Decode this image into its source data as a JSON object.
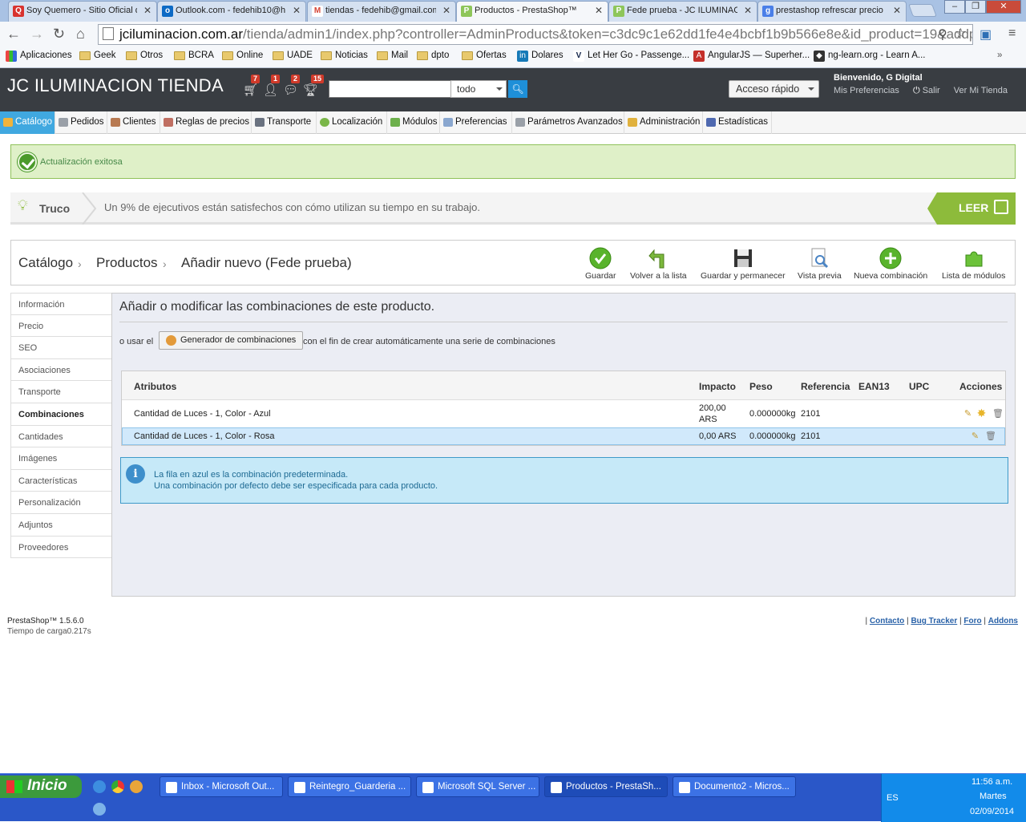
{
  "browser": {
    "tabs": [
      {
        "label": "Soy Quemero - Sitio Oficial d",
        "icon": "quemero-icon",
        "color": "#d8332f"
      },
      {
        "label": "Outlook.com - fedehib10@h",
        "icon": "outlook-icon",
        "color": "#0d6ac5"
      },
      {
        "label": "tiendas - fedehib@gmail.com",
        "icon": "gmail-icon",
        "color": "#d64536"
      },
      {
        "label": "Productos - PrestaShop™",
        "icon": "prestashop-icon",
        "color": "#8ec65a"
      },
      {
        "label": "Fede prueba - JC ILUMINAC",
        "icon": "prestashop-icon",
        "color": "#8ec65a"
      },
      {
        "label": "prestashop refrescar precio",
        "icon": "google-icon",
        "color": "#4a7fe8"
      }
    ],
    "url_host": "jciluminacion.com.ar",
    "url_rest": "/tienda/admin1/index.php?controller=AdminProducts&token=c3dc9c1e62dd1fe4e4bcbf1b9b566e8e&id_product=19&addp",
    "bookmarks": [
      {
        "label": "Aplicaciones",
        "type": "apps"
      },
      {
        "label": "Geek",
        "type": "folder"
      },
      {
        "label": "Otros",
        "type": "folder"
      },
      {
        "label": "BCRA",
        "type": "folder"
      },
      {
        "label": "Online",
        "type": "folder"
      },
      {
        "label": "UADE",
        "type": "folder"
      },
      {
        "label": "Noticias",
        "type": "folder"
      },
      {
        "label": "Mail",
        "type": "folder"
      },
      {
        "label": "dpto",
        "type": "folder"
      },
      {
        "label": "Ofertas",
        "type": "folder"
      },
      {
        "label": "Dolares",
        "type": "linkedin"
      },
      {
        "label": "Let Her Go - Passenge...",
        "type": "vimeo"
      },
      {
        "label": "AngularJS — Superher...",
        "type": "angular"
      },
      {
        "label": "ng-learn.org - Learn A...",
        "type": "ngshield"
      }
    ]
  },
  "ps": {
    "title": "JC ILUMINACION TIENDA",
    "notifications": [
      {
        "icon": "cart-icon",
        "count": "7"
      },
      {
        "icon": "customers-icon",
        "count": "1"
      },
      {
        "icon": "messages-icon",
        "count": "2"
      },
      {
        "icon": "trophy-icon",
        "count": "15"
      }
    ],
    "search_scope": "todo",
    "quick_access": "Acceso rápido",
    "welcome": "Bienvenido, G Digital",
    "links": {
      "prefs": "Mis Preferencias",
      "logout": "Salir",
      "store": "Ver Mi Tienda"
    },
    "menu": [
      {
        "label": "Catálogo",
        "active": true,
        "color": "#f0b33b"
      },
      {
        "label": "Pedidos",
        "active": false,
        "color": "#9aa0a8"
      },
      {
        "label": "Clientes",
        "active": false,
        "color": "#b87a52"
      },
      {
        "label": "Reglas de precios",
        "active": false,
        "color": "#c06f62"
      },
      {
        "label": "Transporte",
        "active": false,
        "color": "#6a7280"
      },
      {
        "label": "Localización",
        "active": false,
        "color": "#7ab648"
      },
      {
        "label": "Módulos",
        "active": false,
        "color": "#6db04c"
      },
      {
        "label": "Preferencias",
        "active": false,
        "color": "#8aa7cf"
      },
      {
        "label": "Parámetros Avanzados",
        "active": false,
        "color": "#9aa0a8"
      },
      {
        "label": "Administración",
        "active": false,
        "color": "#e0b13d"
      },
      {
        "label": "Estadísticas",
        "active": false,
        "color": "#4f69b0"
      }
    ],
    "success_msg": "Actualización exitosa",
    "tip": {
      "label": "Truco",
      "text": "Un 9% de ejecutivos están satisfechos con cómo utilizan su tiempo en su trabajo.",
      "read": "LEER"
    },
    "breadcrumb": [
      "Catálogo",
      "Productos",
      "Añadir nuevo (Fede prueba)"
    ],
    "toolbar": [
      {
        "label": "Guardar",
        "icon": "save-check-icon"
      },
      {
        "label": "Volver a la lista",
        "icon": "back-arrow-icon"
      },
      {
        "label": "Guardar y permanecer",
        "icon": "floppy-disk-icon"
      },
      {
        "label": "Vista previa",
        "icon": "preview-icon"
      },
      {
        "label": "Nueva combinación",
        "icon": "add-plus-icon"
      },
      {
        "label": "Lista de módulos",
        "icon": "puzzle-icon"
      }
    ],
    "side_tabs": [
      {
        "label": "Información"
      },
      {
        "label": "Precio"
      },
      {
        "label": "SEO"
      },
      {
        "label": "Asociaciones"
      },
      {
        "label": "Transporte"
      },
      {
        "label": "Combinaciones",
        "active": true
      },
      {
        "label": "Cantidades"
      },
      {
        "label": "Imágenes"
      },
      {
        "label": "Características"
      },
      {
        "label": "Personalización"
      },
      {
        "label": "Adjuntos"
      },
      {
        "label": "Proveedores"
      }
    ],
    "panel_title": "Añadir o modificar las combinaciones de este producto.",
    "gen_prefix": "o usar el",
    "gen_button": "Generador de combinaciones",
    "gen_suffix": "con el fin de crear automáticamente una serie de combinaciones",
    "table": {
      "headers": [
        "Atributos",
        "Impacto",
        "Peso",
        "Referencia",
        "EAN13",
        "UPC",
        "Acciones"
      ],
      "rows": [
        {
          "attr": "Cantidad de Luces - 1, Color - Azul",
          "impact1": "200,00",
          "impact2": "ARS",
          "weight": "0.000000kg",
          "ref": "2101",
          "default": false
        },
        {
          "attr": "Cantidad de Luces - 1, Color - Rosa",
          "impact1": "0,00 ARS",
          "impact2": "",
          "weight": "0.000000kg",
          "ref": "2101",
          "default": true
        }
      ]
    },
    "info_line1": "La fila en azul es la combinación predeterminada.",
    "info_line2": "Una combinación por defecto debe ser especificada para cada producto.",
    "footer_version": "PrestaShop™ 1.5.6.0",
    "footer_load": "Tiempo de carga0.217s",
    "footer_links": [
      "Contacto",
      "Bug Tracker",
      "Foro",
      "Addons"
    ]
  },
  "taskbar": {
    "start": "Inicio",
    "tasks": [
      "Inbox - Microsoft Out...",
      "Reintegro_Guarderia ...",
      "Microsoft SQL Server ...",
      "Productos - PrestaSh...",
      "Documento2 - Micros..."
    ],
    "lang": "ES",
    "time": "11:56 a.m.",
    "day": "Martes",
    "date": "02/09/2014"
  }
}
